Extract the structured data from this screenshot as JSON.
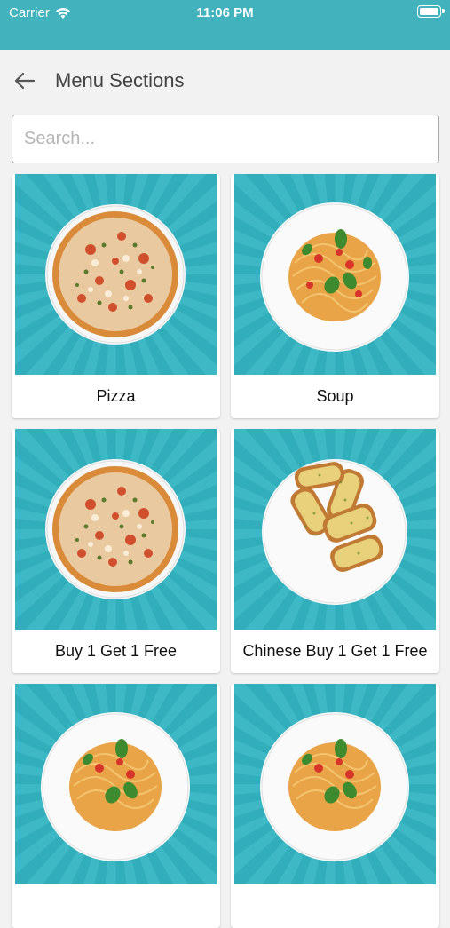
{
  "status_bar": {
    "carrier": "Carrier",
    "time": "11:06 PM"
  },
  "nav": {
    "title": "Menu Sections",
    "back_icon": "back-arrow-icon"
  },
  "search": {
    "placeholder": "Search..."
  },
  "sections": [
    {
      "label": "Pizza",
      "image": "pizza"
    },
    {
      "label": "Soup",
      "image": "spaghetti"
    },
    {
      "label": "Buy 1 Get 1 Free",
      "image": "pizza"
    },
    {
      "label": "Chinese Buy 1 Get 1 Free",
      "image": "garlic-bread"
    },
    {
      "label": "",
      "image": "spaghetti"
    },
    {
      "label": "",
      "image": "spaghetti"
    }
  ],
  "colors": {
    "accent": "#42b3bd",
    "tile_bg": "#33b4c1"
  }
}
